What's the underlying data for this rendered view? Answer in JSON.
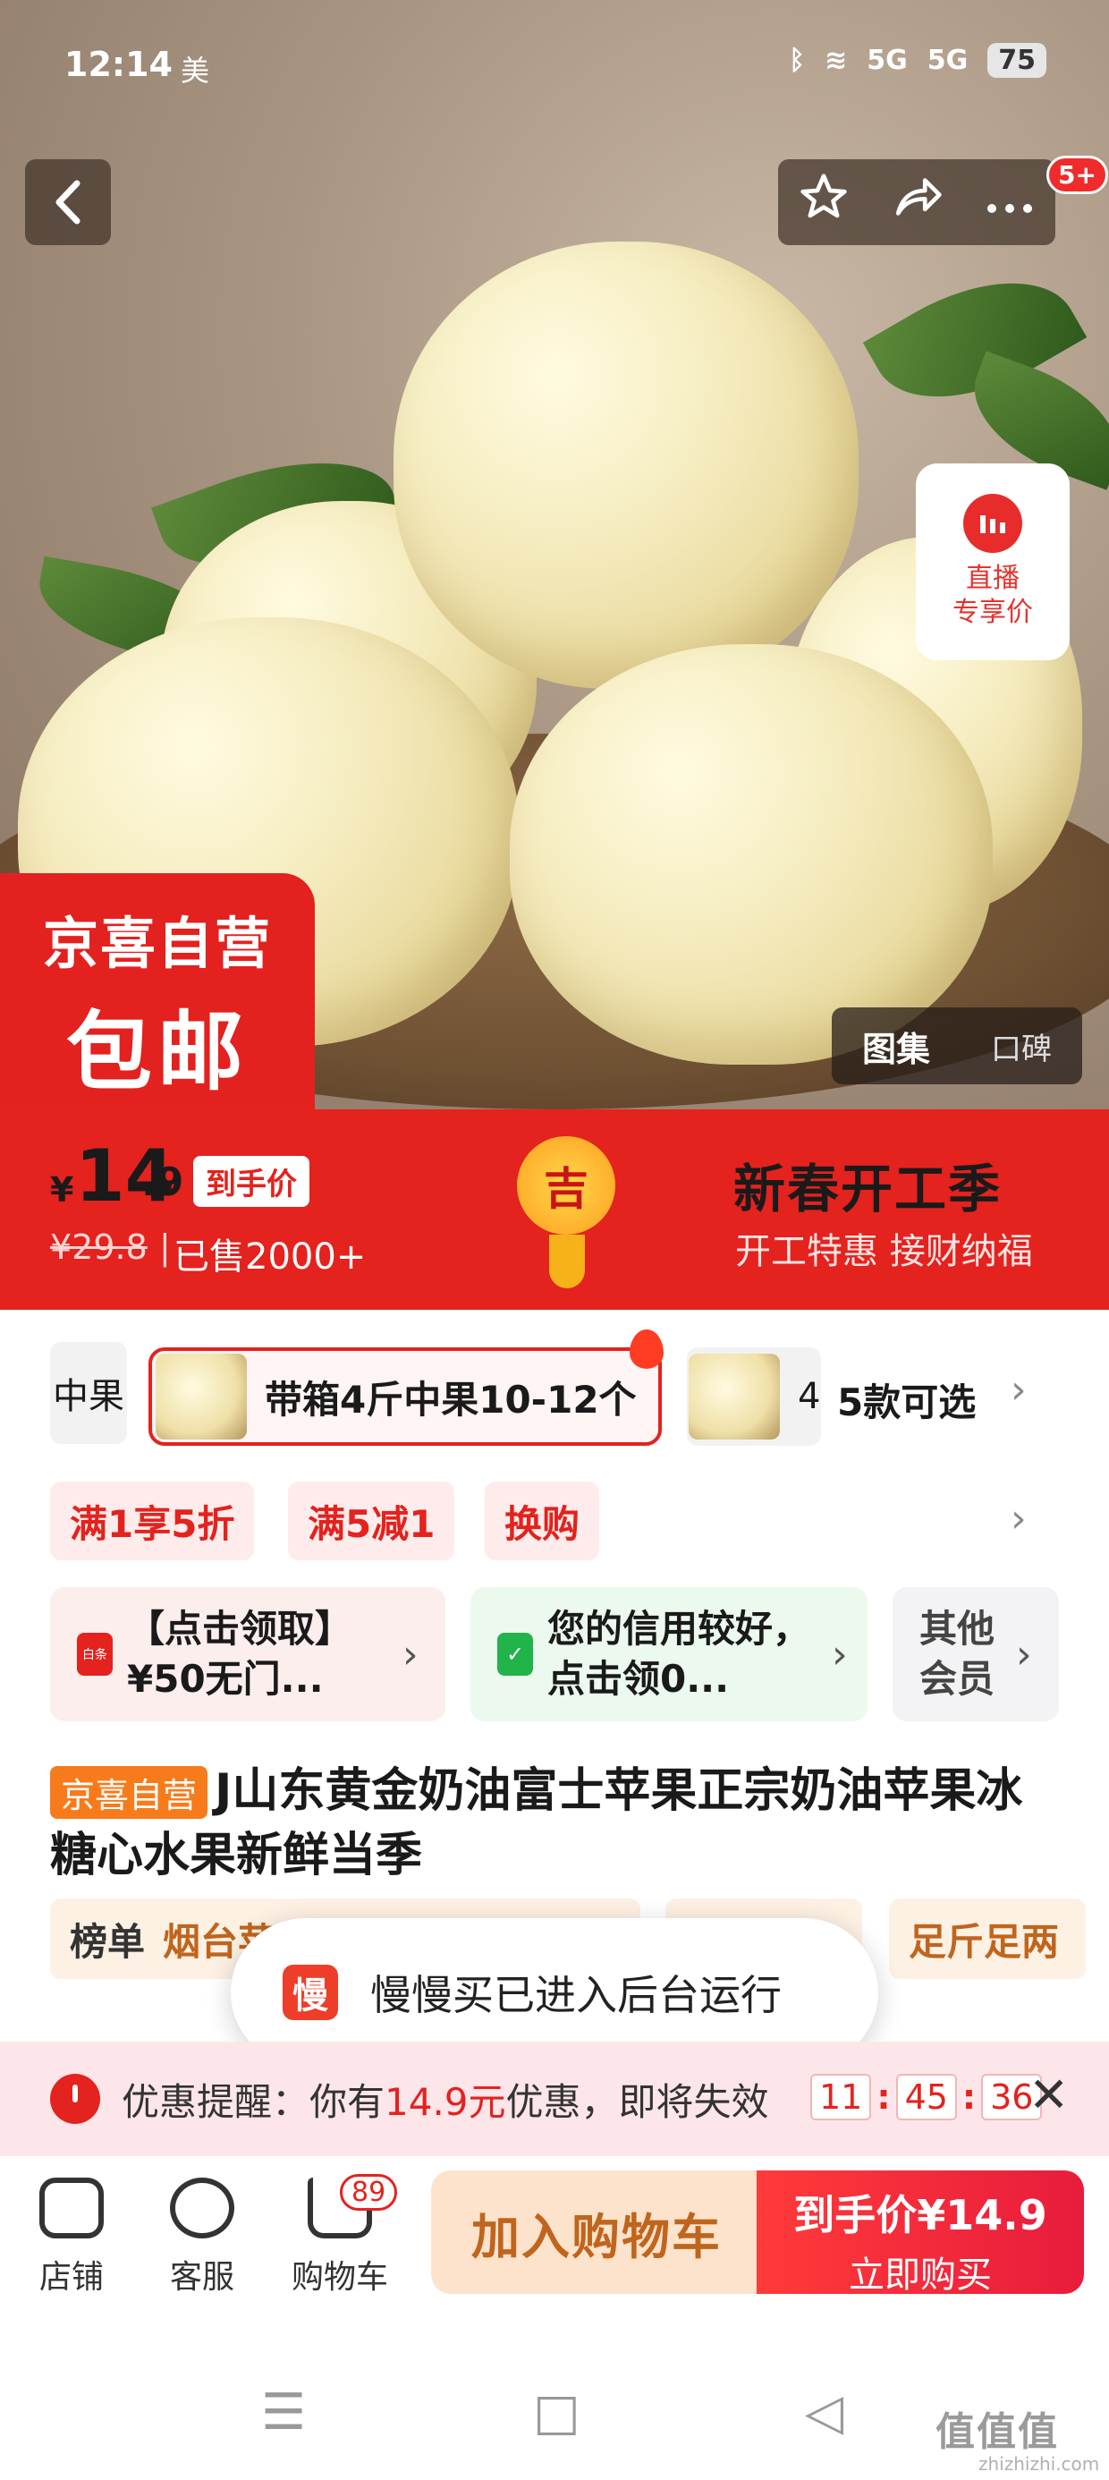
{
  "status_bar": {
    "time": "12:14",
    "carrier": "美",
    "bluetooth": "ᛒ",
    "wifi": "≋",
    "signal_1": "5G",
    "signal_2": "5G",
    "battery": "75"
  },
  "nav": {
    "back_icon": "chevron-left-icon",
    "star_icon": "star-icon",
    "share_icon": "share-icon",
    "more_icon": "more-icon",
    "message_badge": "5+"
  },
  "hero": {
    "live_badge_line1": "直播",
    "live_badge_line2": "专享价",
    "store_badge_line1": "京喜自营",
    "store_badge_line2": "包邮",
    "gallery_tab_active": "图集",
    "gallery_tab_inactive": "口碑"
  },
  "price": {
    "currency": "¥",
    "main": "14",
    "decimal": ".9",
    "tag": "到手价",
    "original": "¥29.8",
    "separator": "|",
    "sold": "已售2000+",
    "lucky_char": "吉",
    "festival_title": "新春开工季",
    "festival_subtitle": "开工特惠 接财纳福"
  },
  "variants": {
    "left_partial": "中果",
    "selected": "带箱4斤中果10-12个",
    "next_partial": "4",
    "count_label": "5款可选"
  },
  "promos": [
    "满1享5折",
    "满5减1",
    "换购"
  ],
  "coupons": [
    {
      "icon_text": "白条",
      "text": "【点击领取】¥50无门..."
    },
    {
      "icon_text": "✓",
      "text": "您的信用较好，点击领0..."
    },
    {
      "icon_text": "",
      "text": "其他会员"
    }
  ],
  "product": {
    "store_tag": "京喜自营",
    "title": "J山东黄金奶油富士苹果正宗奶油苹果冰糖心水果新鲜当季"
  },
  "rank": {
    "rank_label": "榜单",
    "rank_value": "烟台苹",
    "right_chip": "足斤足两"
  },
  "toast": {
    "icon_text": "慢",
    "text": "慢慢买已进入后台运行"
  },
  "reminder": {
    "prefix": "优惠提醒：你有",
    "amount": "14.9元",
    "suffix": "优惠，即将失效",
    "hh": "11",
    "mm": "45",
    "ss": "36",
    "close": "✕"
  },
  "bottom_bar": {
    "store_label": "店铺",
    "service_label": "客服",
    "cart_label": "购物车",
    "cart_badge": "89",
    "add_cart": "加入购物车",
    "buy_price": "到手价¥14.9",
    "buy_now": "立即购买"
  },
  "system_nav": {
    "menu": "☰",
    "home": "□",
    "back": "◁"
  },
  "watermark": {
    "text": "值值值",
    "sub": "zhizhizhi.com"
  },
  "colors": {
    "brand_red": "#e4221e",
    "orange_tag": "#f77b1b",
    "cart_button": "#fde3cc"
  }
}
